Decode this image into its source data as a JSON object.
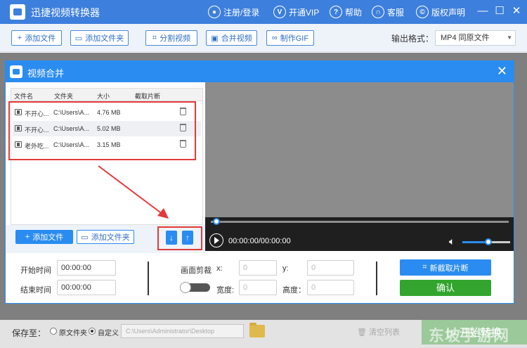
{
  "app": {
    "title": "迅捷视频转换器",
    "nav": {
      "login": "注册/登录",
      "vip": "开通VIP",
      "help": "帮助",
      "service": "客服",
      "copyright": "版权声明"
    },
    "win_controls": {
      "minimize": "—",
      "maximize": "☐",
      "close": "✕"
    }
  },
  "toolbar": {
    "add_file": "添加文件",
    "add_folder": "添加文件夹",
    "split_video": "分割视频",
    "merge_video": "合并视频",
    "make_gif": "制作GIF",
    "output_format_label": "输出格式：",
    "output_format_value": "MP4  同原文件"
  },
  "dialog": {
    "title": "视频合并",
    "columns": [
      "文件名",
      "文件夹",
      "大小",
      "截取片断"
    ],
    "files": [
      {
        "name": "不开心...",
        "folder": "C:\\Users\\A...",
        "size": "4.76 MB"
      },
      {
        "name": "不开心...",
        "folder": "C:\\Users\\A...",
        "size": "5.02 MB"
      },
      {
        "name": "老外吃...",
        "folder": "C:\\Users\\A...",
        "size": "3.15 MB"
      }
    ],
    "add_file": "添加文件",
    "add_folder": "添加文件夹",
    "move_down": "↓",
    "move_up": "↑",
    "player": {
      "time": "00:00:00/00:00:00",
      "progress": 0,
      "volume": 0.55
    },
    "start_time_label": "开始时间",
    "start_time_value": "00:00:00",
    "end_time_label": "结束时间",
    "end_time_value": "00:00:00",
    "crop_label": "画面剪裁",
    "x_label": "x:",
    "x_value": "0",
    "y_label": "y:",
    "y_value": "0",
    "width_label": "宽度:",
    "width_value": "0",
    "height_label": "高度：",
    "height_value": "0",
    "new_clip": "新截取片断",
    "confirm": "确认"
  },
  "footer": {
    "save_to_label": "保存至：",
    "original_folder": "原文件夹",
    "custom": "自定义",
    "path": "C:\\Users\\Administrator\\Desktop",
    "clear_list": "清空列表",
    "start_convert": "开始转换"
  },
  "watermark": "东坡手游网",
  "colors": {
    "title_bar": "#3d7fdc",
    "accent": "#2a8cf0",
    "confirm": "#33a52e",
    "annotation": "#e13a3a"
  }
}
